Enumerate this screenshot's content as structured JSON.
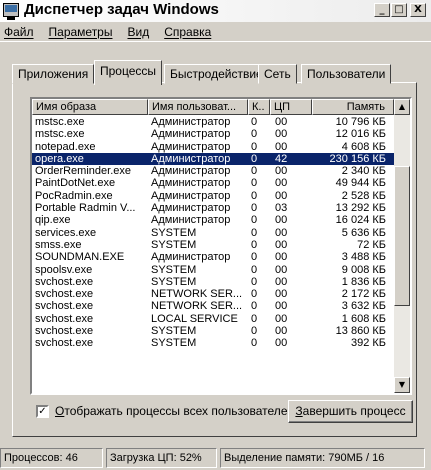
{
  "window": {
    "title": "Диспетчер задач Windows",
    "minimize_glyph": "_",
    "maximize_glyph": "□",
    "close_glyph": "X"
  },
  "menu": [
    "Файл",
    "Параметры",
    "Вид",
    "Справка"
  ],
  "tabs": [
    {
      "label": "Приложения",
      "active": false
    },
    {
      "label": "Процессы",
      "active": true
    },
    {
      "label": "Быстродействие",
      "active": false
    },
    {
      "label": "Сеть",
      "active": false
    },
    {
      "label": "Пользователи",
      "active": false
    }
  ],
  "process_table": {
    "columns": [
      "Имя образа",
      "Имя пользоват...",
      "К..",
      "ЦП",
      "Память"
    ],
    "rows": [
      [
        "mstsc.exe",
        "Администратор",
        "0",
        "00",
        "10 796 КБ"
      ],
      [
        "mstsc.exe",
        "Администратор",
        "0",
        "00",
        "12 016 КБ"
      ],
      [
        "notepad.exe",
        "Администратор",
        "0",
        "00",
        "4 608 КБ"
      ],
      [
        "opera.exe",
        "Администратор",
        "0",
        "42",
        "230 156 КБ"
      ],
      [
        "OrderReminder.exe",
        "Администратор",
        "0",
        "00",
        "2 340 КБ"
      ],
      [
        "PaintDotNet.exe",
        "Администратор",
        "0",
        "00",
        "49 944 КБ"
      ],
      [
        "PocRadmin.exe",
        "Администратор",
        "0",
        "00",
        "2 528 КБ"
      ],
      [
        "Portable Radmin V...",
        "Администратор",
        "0",
        "03",
        "13 292 КБ"
      ],
      [
        "qip.exe",
        "Администратор",
        "0",
        "00",
        "16 024 КБ"
      ],
      [
        "services.exe",
        "SYSTEM",
        "0",
        "00",
        "5 636 КБ"
      ],
      [
        "smss.exe",
        "SYSTEM",
        "0",
        "00",
        "72 КБ"
      ],
      [
        "SOUNDMAN.EXE",
        "Администратор",
        "0",
        "00",
        "3 488 КБ"
      ],
      [
        "spoolsv.exe",
        "SYSTEM",
        "0",
        "00",
        "9 008 КБ"
      ],
      [
        "svchost.exe",
        "SYSTEM",
        "0",
        "00",
        "1 836 КБ"
      ],
      [
        "svchost.exe",
        "NETWORK SER...",
        "0",
        "00",
        "2 172 КБ"
      ],
      [
        "svchost.exe",
        "NETWORK SER...",
        "0",
        "00",
        "3 632 КБ"
      ],
      [
        "svchost.exe",
        "LOCAL SERVICE",
        "0",
        "00",
        "1 608 КБ"
      ],
      [
        "svchost.exe",
        "SYSTEM",
        "0",
        "00",
        "13 860 КБ"
      ],
      [
        "svchost.exe",
        "SYSTEM",
        "0",
        "00",
        "392 КБ"
      ]
    ],
    "selected_row": 3,
    "scroll_up_glyph": "▲",
    "scroll_down_glyph": "▼"
  },
  "show_all_users": {
    "label": "Отображать процессы всех пользователей",
    "checked": true,
    "check_glyph": "✓"
  },
  "end_process_button": "Завершить процесс",
  "statusbar": {
    "processes": "Процессов: 46",
    "cpu": "Загрузка ЦП: 52%",
    "memory": "Выделение памяти: 790МБ / 16"
  },
  "colors": {
    "selection": "#0a246a",
    "face": "#d4d0c8"
  }
}
